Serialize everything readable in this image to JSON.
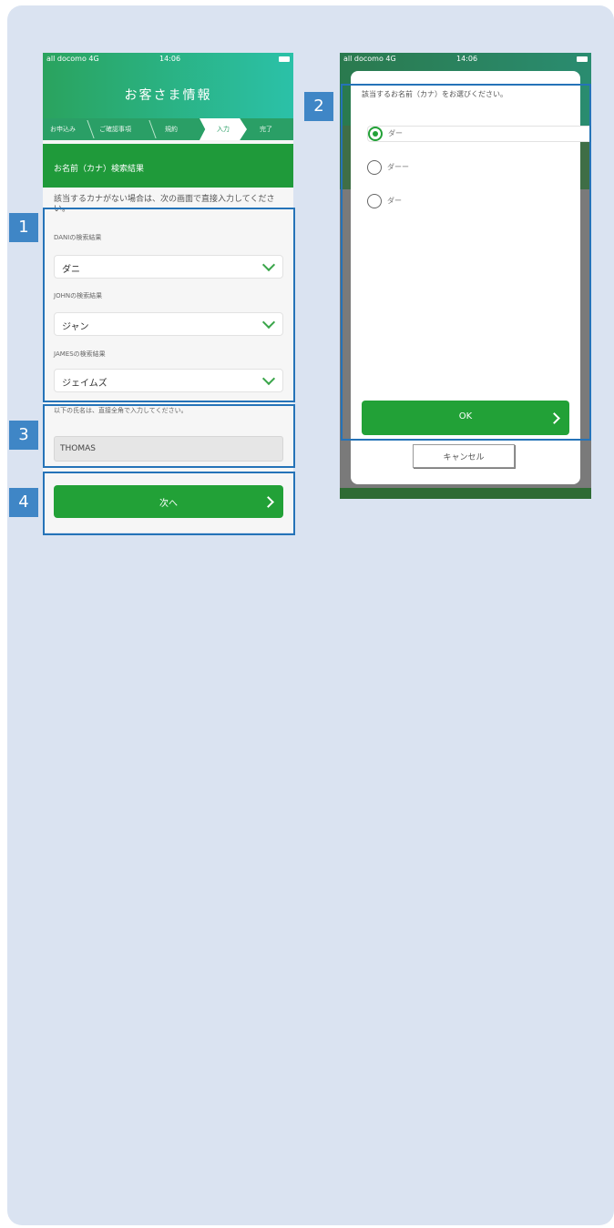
{
  "left_screen": {
    "status": {
      "carrier": "all docomo 4G",
      "time": "14:06"
    },
    "title": "お客さま情報",
    "steps": [
      "お申込み",
      "ご確認事項",
      "規約",
      "入力",
      "完了"
    ],
    "active_step_index": 3,
    "section_title": "お名前（カナ）検索結果",
    "intro": "該当するカナがない場合は、次の画面で直接入力してください。",
    "fields": [
      {
        "label": "DANIの検索結果",
        "value": "ダニ"
      },
      {
        "label": "JOHNの検索結果",
        "value": "ジャン"
      },
      {
        "label": "JAMESの検索結果",
        "value": "ジェイムズ"
      }
    ],
    "note": "以下の氏名は、直接全角で入力してください。",
    "manual_input_value": "THOMAS",
    "next_button": "次へ"
  },
  "right_screen": {
    "status": {
      "carrier": "all docomo 4G",
      "time": "14:06"
    },
    "dialog_title": "該当するお名前（カナ）をお選びください。",
    "options": [
      {
        "label": "ダー",
        "selected": true
      },
      {
        "label": "ダーー",
        "selected": false
      },
      {
        "label": "ダー",
        "selected": false
      }
    ],
    "ok_button": "OK",
    "cancel_button": "キャンセル"
  },
  "annotations": [
    "1",
    "2",
    "3",
    "4"
  ],
  "colors": {
    "accent_green": "#22a137",
    "highlight_blue": "#2573b8",
    "badge_blue": "#3f86c6",
    "card_bg": "#dae3f1"
  }
}
